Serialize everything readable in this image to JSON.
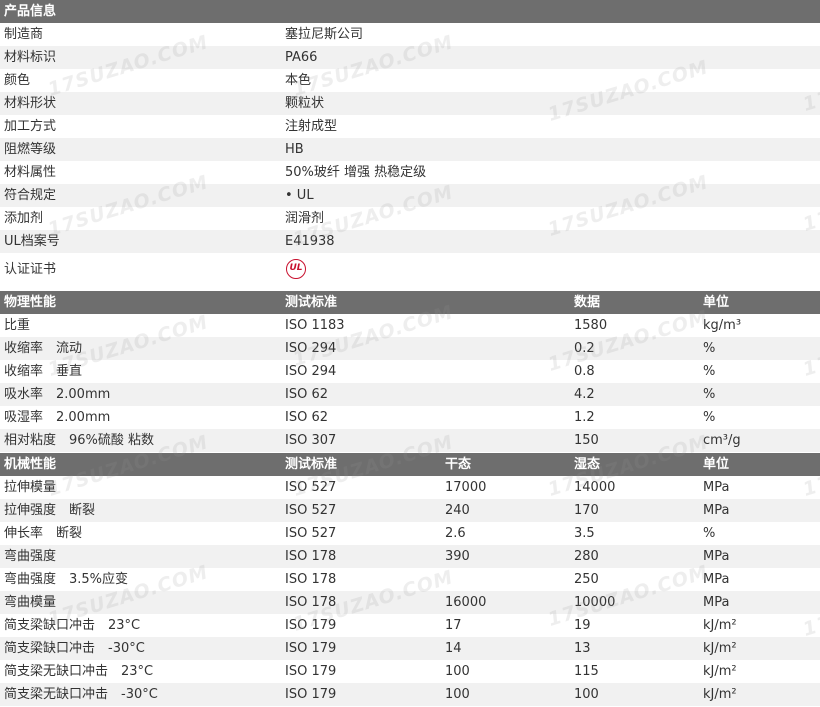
{
  "watermark": "17SUZAO.COM",
  "colors": {
    "header_bg": "#6e6e6e",
    "alt_row_bg": "#f1f1f1",
    "ul_mark": "#c8102e"
  },
  "product_info": {
    "title": "产品信息",
    "rows": [
      {
        "label": "制造商",
        "value": "塞拉尼斯公司"
      },
      {
        "label": "材料标识",
        "value": "PA66"
      },
      {
        "label": "颜色",
        "value": "本色"
      },
      {
        "label": "材料形状",
        "value": "颗粒状"
      },
      {
        "label": "加工方式",
        "value": "注射成型"
      },
      {
        "label": "阻燃等级",
        "value": "HB"
      },
      {
        "label": "材料属性",
        "value": "50%玻纤 增强 热稳定级"
      },
      {
        "label": "符合规定",
        "value": "• UL"
      },
      {
        "label": "添加剂",
        "value": "润滑剂"
      },
      {
        "label": "UL档案号",
        "value": "E41938"
      }
    ],
    "cert": {
      "label": "认证证书",
      "mark_text": "UL"
    }
  },
  "physical": {
    "headers": [
      "物理性能",
      "测试标准",
      "数据",
      "单位"
    ],
    "rows": [
      {
        "name": "比重",
        "std": "ISO 1183",
        "value": "1580",
        "unit": "kg/m³"
      },
      {
        "name": "收缩率　流动",
        "std": "ISO 294",
        "value": "0.2",
        "unit": "%"
      },
      {
        "name": "收缩率　垂直",
        "std": "ISO 294",
        "value": "0.8",
        "unit": "%"
      },
      {
        "name": "吸水率　2.00mm",
        "std": "ISO 62",
        "value": "4.2",
        "unit": "%"
      },
      {
        "name": "吸湿率　2.00mm",
        "std": "ISO 62",
        "value": "1.2",
        "unit": "%"
      },
      {
        "name": "相对粘度　96%硫酸 粘数",
        "std": "ISO 307",
        "value": "150",
        "unit": "cm³/g"
      }
    ]
  },
  "mechanical": {
    "headers": [
      "机械性能",
      "测试标准",
      "干态",
      "湿态",
      "单位"
    ],
    "rows": [
      {
        "name": "拉伸模量",
        "std": "ISO 527",
        "dry": "17000",
        "wet": "14000",
        "unit": "MPa"
      },
      {
        "name": "拉伸强度　断裂",
        "std": "ISO 527",
        "dry": "240",
        "wet": "170",
        "unit": "MPa"
      },
      {
        "name": "伸长率　断裂",
        "std": "ISO 527",
        "dry": "2.6",
        "wet": "3.5",
        "unit": "%"
      },
      {
        "name": "弯曲强度",
        "std": "ISO 178",
        "dry": "390",
        "wet": "280",
        "unit": "MPa"
      },
      {
        "name": "弯曲强度　3.5%应变",
        "std": "ISO 178",
        "dry": "",
        "wet": "250",
        "unit": "MPa"
      },
      {
        "name": "弯曲模量",
        "std": "ISO 178",
        "dry": "16000",
        "wet": "10000",
        "unit": "MPa"
      },
      {
        "name": "简支梁缺口冲击　23°C",
        "std": "ISO 179",
        "dry": "17",
        "wet": "19",
        "unit": "kJ/m²"
      },
      {
        "name": "简支梁缺口冲击　-30°C",
        "std": "ISO 179",
        "dry": "14",
        "wet": "13",
        "unit": "kJ/m²"
      },
      {
        "name": "简支梁无缺口冲击　23°C",
        "std": "ISO 179",
        "dry": "100",
        "wet": "115",
        "unit": "kJ/m²"
      },
      {
        "name": "简支梁无缺口冲击　-30°C",
        "std": "ISO 179",
        "dry": "100",
        "wet": "100",
        "unit": "kJ/m²"
      }
    ]
  }
}
